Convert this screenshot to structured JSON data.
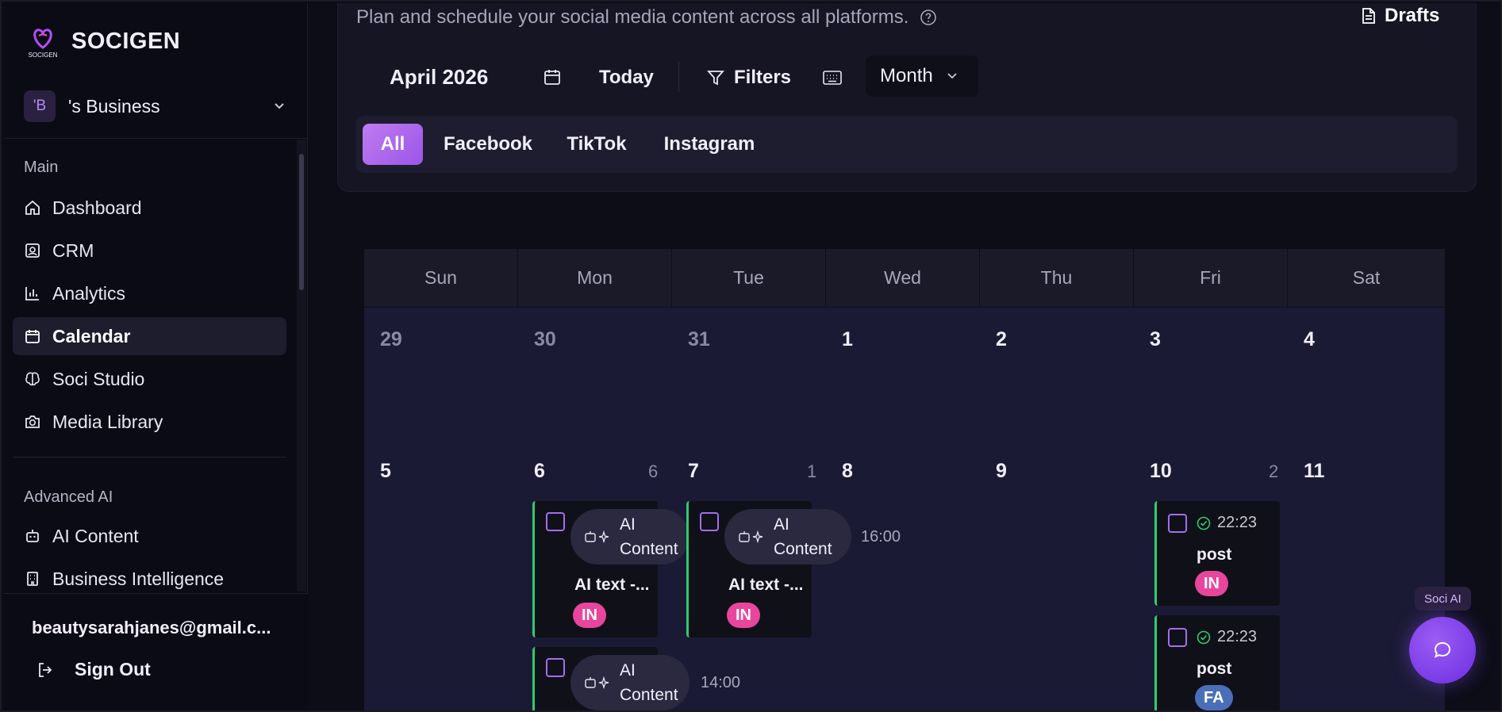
{
  "app": {
    "name": "SOCIGEN",
    "logo_text": "SOCIGEN"
  },
  "business": {
    "avatar": "'B",
    "name": "'s Business"
  },
  "nav": {
    "main_label": "Main",
    "main_items": [
      {
        "label": "Dashboard",
        "icon": "home-icon"
      },
      {
        "label": "CRM",
        "icon": "contact-icon"
      },
      {
        "label": "Analytics",
        "icon": "bar-chart-icon"
      },
      {
        "label": "Calendar",
        "icon": "calendar-icon",
        "active": true
      },
      {
        "label": "Soci Studio",
        "icon": "brain-icon"
      },
      {
        "label": "Media Library",
        "icon": "camera-icon"
      }
    ],
    "advanced_label": "Advanced AI",
    "advanced_items": [
      {
        "label": "AI Content",
        "icon": "robot-icon"
      },
      {
        "label": "Business Intelligence",
        "icon": "building-icon"
      }
    ]
  },
  "footer": {
    "email": "beautysarahjanes@gmail.c...",
    "signout": "Sign Out"
  },
  "header": {
    "subtitle": "Plan and schedule your social media content across all platforms.",
    "drafts": "Drafts"
  },
  "toolbar": {
    "month": "April 2026",
    "today": "Today",
    "filters": "Filters",
    "view": "Month"
  },
  "platform_tabs": [
    "All",
    "Facebook",
    "TikTok",
    "Instagram"
  ],
  "calendar": {
    "weekdays": [
      "Sun",
      "Mon",
      "Tue",
      "Wed",
      "Thu",
      "Fri",
      "Sat"
    ],
    "week1": [
      "29",
      "30",
      "31",
      "1",
      "2",
      "3",
      "4"
    ],
    "week2": [
      "5",
      "6",
      "7",
      "8",
      "9",
      "10",
      "11"
    ],
    "counts": {
      "mon": "6",
      "tue": "1",
      "fri": "2"
    },
    "posts": {
      "ai_label": "AI\nContent",
      "ai_title": "AI text -...",
      "tue_time": "16:00",
      "mon2_time": "14:00",
      "fri_time": "22:23",
      "fri_title": "post",
      "badge_in": "IN",
      "badge_fa": "FA"
    }
  },
  "soci_ai": {
    "label": "Soci AI"
  },
  "colors": {
    "accent": "#a36ef0",
    "post_border": "#2ecc71",
    "badge_in": "#e8459c",
    "badge_fa": "#4a6fb8"
  }
}
